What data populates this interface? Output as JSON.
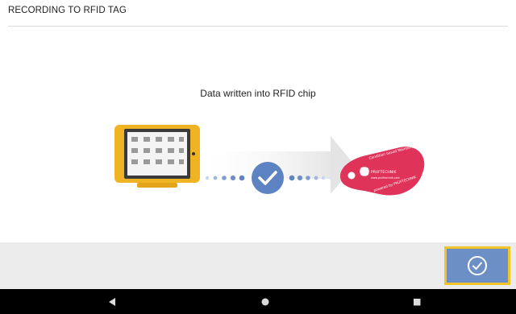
{
  "header": {
    "title": "RECORDING TO RFID TAG"
  },
  "main": {
    "status_message": "Data written into RFID chip",
    "tag_text": {
      "line1": "Condition based Maintenance",
      "line2": "powered by PRÜFTECHNIK",
      "brand": "PRUFTECHNIK",
      "url": "www.pruftechnik.com"
    }
  },
  "footer": {
    "confirm_icon": "check-circle-icon"
  },
  "navbar": {
    "back_icon": "triangle-back-icon",
    "home_icon": "circle-home-icon",
    "recents_icon": "square-recents-icon"
  },
  "colors": {
    "accent_blue": "#6c8fc6",
    "highlight_yellow": "#f2c42a",
    "device_yellow": "#f0b323",
    "tag_pink": "#e0335a"
  }
}
